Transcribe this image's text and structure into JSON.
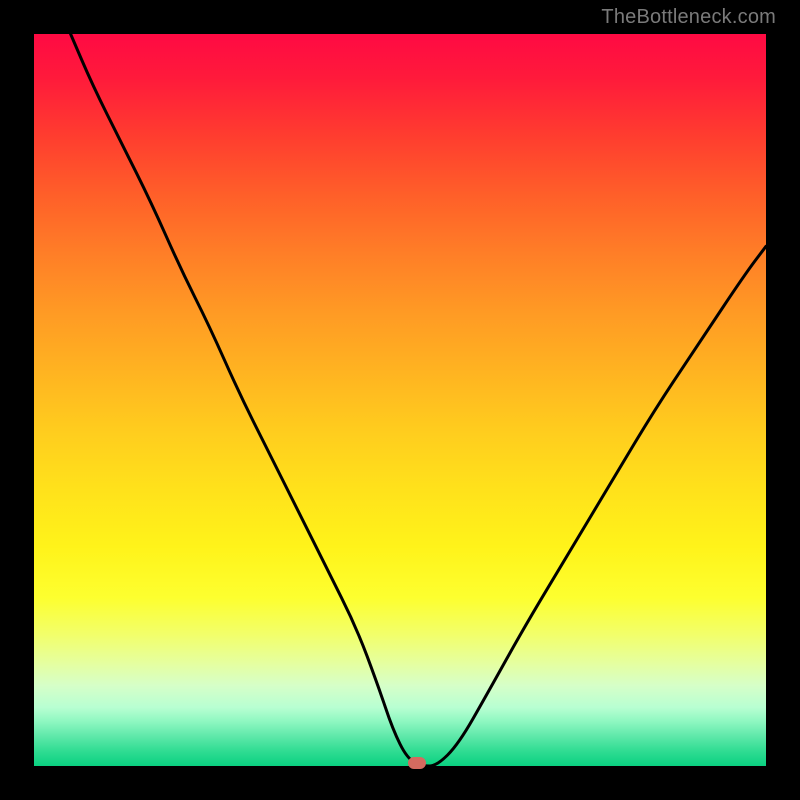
{
  "watermark": "TheBottleneck.com",
  "marker": {
    "x_frac": 0.523,
    "y_frac": 0.0
  },
  "chart_data": {
    "type": "line",
    "title": "",
    "xlabel": "",
    "ylabel": "",
    "xlim": [
      0,
      100
    ],
    "ylim": [
      0,
      100
    ],
    "series": [
      {
        "name": "bottleneck-curve",
        "x": [
          5,
          8,
          12,
          16,
          20,
          24,
          28,
          32,
          36,
          40,
          44,
          47,
          49,
          51,
          53,
          55,
          58,
          62,
          67,
          73,
          79,
          85,
          91,
          97,
          100
        ],
        "y": [
          100,
          93,
          85,
          77,
          68,
          60,
          51,
          43,
          35,
          27,
          19,
          11,
          5,
          1,
          0,
          0,
          3,
          10,
          19,
          29,
          39,
          49,
          58,
          67,
          71
        ]
      }
    ],
    "annotations": [
      {
        "type": "marker",
        "x": 52.3,
        "y": 0,
        "shape": "rounded-rect",
        "color": "#d46a5f"
      }
    ],
    "background_gradient": {
      "direction": "top-to-bottom",
      "stops": [
        {
          "pos": 0.0,
          "color": "#ff0a43"
        },
        {
          "pos": 0.5,
          "color": "#ffcc1e"
        },
        {
          "pos": 0.77,
          "color": "#fdff2f"
        },
        {
          "pos": 1.0,
          "color": "#0ad181"
        }
      ]
    }
  }
}
